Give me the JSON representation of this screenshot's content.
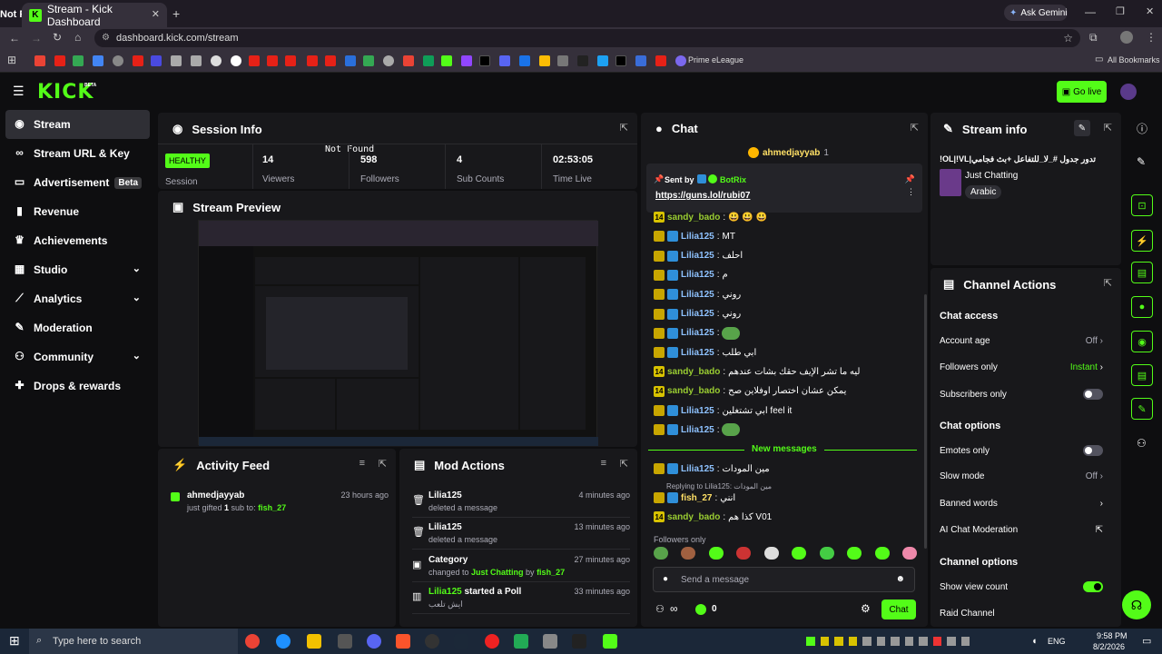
{
  "browser": {
    "tab_title": "Stream - Kick Dashboard",
    "tab_notfound": "Not Found",
    "ask_gemini": "Ask Gemini",
    "url": "dashboard.kick.com/stream",
    "bookmark_prime": "Prime eLeague",
    "bookmark_all": "All Bookmarks"
  },
  "header": {
    "logo": "KICK",
    "logo_beta": "BETA",
    "go_live": "Go live"
  },
  "sidebar": {
    "items": [
      {
        "label": "Stream",
        "icon": "broadcast-icon"
      },
      {
        "label": "Stream URL & Key",
        "icon": "link-icon"
      },
      {
        "label": "Advertisement",
        "icon": "ad-icon",
        "badge": "Beta"
      },
      {
        "label": "Revenue",
        "icon": "chart-icon"
      },
      {
        "label": "Achievements",
        "icon": "trophy-icon"
      },
      {
        "label": "Studio",
        "icon": "grid-icon"
      },
      {
        "label": "Analytics",
        "icon": "analytics-icon"
      },
      {
        "label": "Moderation",
        "icon": "wrench-icon"
      },
      {
        "label": "Community",
        "icon": "community-icon"
      },
      {
        "label": "Drops & rewards",
        "icon": "gift-icon"
      }
    ]
  },
  "session": {
    "title": "Session Info",
    "status": "HEALTHY",
    "status_label": "Session",
    "notfound": "Not Found",
    "stats": [
      {
        "value": "14",
        "label": "Viewers"
      },
      {
        "value": "598",
        "label": "Followers"
      },
      {
        "value": "4",
        "label": "Sub Counts"
      },
      {
        "value": "02:53:05",
        "label": "Time Live"
      }
    ]
  },
  "preview": {
    "title": "Stream Preview"
  },
  "activity": {
    "title": "Activity Feed",
    "items": [
      {
        "user": "ahmedjayyab",
        "text_pre": "just gifted ",
        "count": "1",
        "text_mid": " sub to: ",
        "target": "fish_27",
        "time": "23 hours ago"
      }
    ]
  },
  "modactions": {
    "title": "Mod Actions",
    "items": [
      {
        "title": "Lilia125",
        "desc": "deleted a message",
        "time": "4 minutes ago"
      },
      {
        "title": "Lilia125",
        "desc": "deleted a message",
        "time": "13 minutes ago"
      },
      {
        "title": "Category",
        "desc_pre": "changed to ",
        "desc_cat": "Just Chatting",
        "desc_mid": " by ",
        "desc_user": "fish_27",
        "time": "27 minutes ago"
      },
      {
        "title_user": "Lilia125",
        "title_rest": " started a Poll",
        "desc": "ايش تلعب",
        "time": "33 minutes ago"
      }
    ]
  },
  "chat": {
    "title": "Chat",
    "top_user": "ahmedjayyab",
    "top_count": "1",
    "pinned_label": "Sent by",
    "pinned_user": "BotRix",
    "pinned_link": "https://guns.lol/rubi07",
    "messages": [
      {
        "user": "sandy_bado",
        "text": "😃 😃 😃",
        "color": "u-green",
        "badge": "14"
      },
      {
        "user": "Lilia125",
        "text": "MT",
        "color": "u-blue"
      },
      {
        "user": "Lilia125",
        "text": "احلف",
        "color": "u-blue"
      },
      {
        "user": "Lilia125",
        "text": "م",
        "color": "u-blue"
      },
      {
        "user": "Lilia125",
        "text": "روني",
        "color": "u-blue"
      },
      {
        "user": "Lilia125",
        "text": "روني",
        "color": "u-blue"
      },
      {
        "user": "Lilia125",
        "text": "",
        "color": "u-blue",
        "emote": true
      },
      {
        "user": "Lilia125",
        "text": "ابي طلب",
        "color": "u-blue"
      },
      {
        "user": "sandy_bado",
        "text": "ليه ما تشر الإيف حقك بشات عندهم",
        "color": "u-green",
        "badge": "14"
      },
      {
        "user": "sandy_bado",
        "text": "يمكن عشان اختصار اوفلاين صح",
        "color": "u-green",
        "badge": "14"
      },
      {
        "user": "Lilia125",
        "text": "ابي تشتغلين feel it",
        "color": "u-blue"
      },
      {
        "user": "Lilia125",
        "text": "",
        "color": "u-blue",
        "emote": true
      }
    ],
    "new_messages": "New messages",
    "messages2": [
      {
        "user": "Lilia125",
        "text": "مين المودات",
        "color": "u-blue"
      }
    ],
    "reply_to": "Replying to Lilia125: مين المودات",
    "messages3": [
      {
        "user": "fish_27",
        "text": "انني",
        "color": "u-yellow"
      },
      {
        "user": "sandy_bado",
        "text": "كذا هم V01",
        "color": "u-green",
        "badge": "14"
      }
    ],
    "followers_only": "Followers only",
    "input_placeholder": "Send a message",
    "points": "0",
    "chat_button": "Chat"
  },
  "streaminfo": {
    "title": "Stream info",
    "stream_title": "!OL|!VL|تدور جدول #_لا_للتفاعل +بث فجامي",
    "category": "Just Chatting",
    "language": "Arabic"
  },
  "channel": {
    "title": "Channel Actions",
    "chat_access": "Chat access",
    "account_age": "Account age",
    "account_age_val": "Off",
    "followers_only": "Followers only",
    "followers_only_val": "Instant",
    "subscribers_only": "Subscribers only",
    "chat_options": "Chat options",
    "emotes_only": "Emotes only",
    "slow_mode": "Slow mode",
    "slow_mode_val": "Off",
    "banned_words": "Banned words",
    "ai_mod": "AI Chat Moderation",
    "channel_options": "Channel options",
    "show_view_count": "Show view count",
    "raid_channel": "Raid Channel"
  },
  "taskbar": {
    "search": "Type here to search",
    "lang": "ENG",
    "time": "9:58 PM",
    "date": "8/2/2026"
  },
  "colors": {
    "accent": "#53fc18",
    "panel": "#18181b",
    "bg": "#0e0e10"
  }
}
